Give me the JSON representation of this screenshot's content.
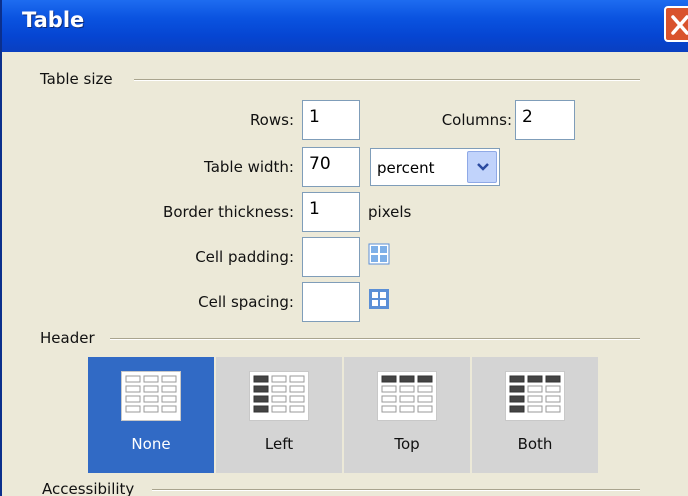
{
  "window": {
    "title": "Table"
  },
  "table_size": {
    "legend": "Table size",
    "rows_label": "Rows:",
    "rows_value": "1",
    "columns_label": "Columns:",
    "columns_value": "2",
    "width_label": "Table width:",
    "width_value": "70",
    "width_unit_selected": "percent",
    "border_label": "Border thickness:",
    "border_value": "1",
    "border_unit": "pixels",
    "padding_label": "Cell padding:",
    "padding_value": "",
    "spacing_label": "Cell spacing:",
    "spacing_value": ""
  },
  "header": {
    "legend": "Header",
    "options": [
      {
        "label": "None",
        "selected": true
      },
      {
        "label": "Left",
        "selected": false
      },
      {
        "label": "Top",
        "selected": false
      },
      {
        "label": "Both",
        "selected": false
      }
    ]
  },
  "accessibility": {
    "legend": "Accessibility"
  },
  "colors": {
    "selected": "#316ac5",
    "titlebar": "#0a53e0",
    "dialog_bg": "#ece9d8"
  }
}
